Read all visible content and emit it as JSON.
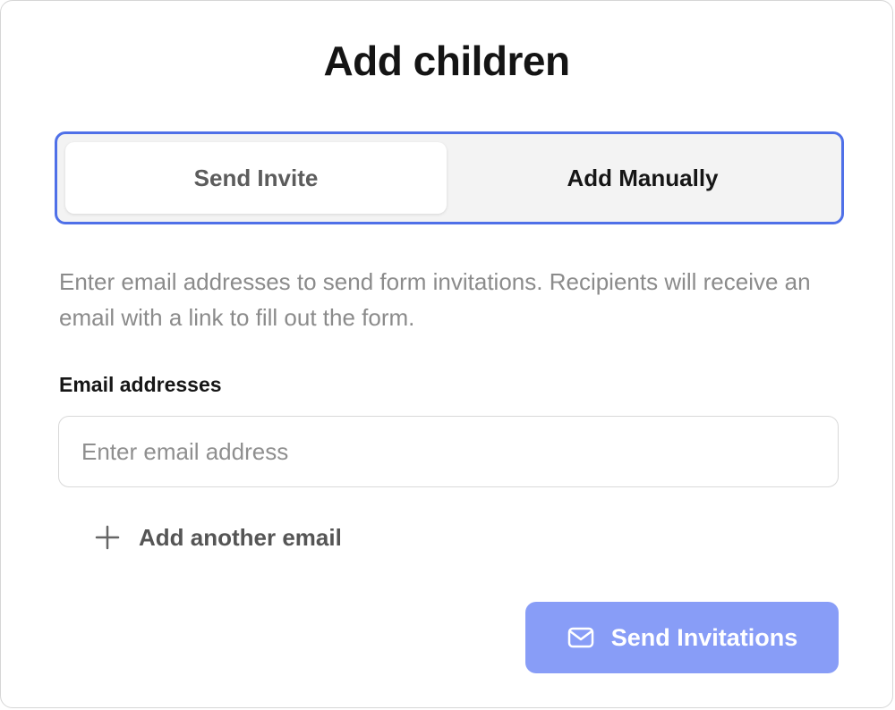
{
  "dialog": {
    "title": "Add children"
  },
  "tabs": [
    {
      "label": "Send Invite",
      "selected": false
    },
    {
      "label": "Add Manually",
      "selected": true
    }
  ],
  "description": "Enter email addresses to send form invitations. Recipients will receive an email with a link to fill out the form.",
  "email_field": {
    "label": "Email addresses",
    "placeholder": "Enter email address",
    "value": ""
  },
  "add_another": {
    "icon": "plus-icon",
    "label": "Add another email"
  },
  "send_button": {
    "icon": "mail-icon",
    "label": "Send Invitations"
  },
  "colors": {
    "focus_ring": "#4f70e8",
    "send_button_bg": "#889df7"
  }
}
